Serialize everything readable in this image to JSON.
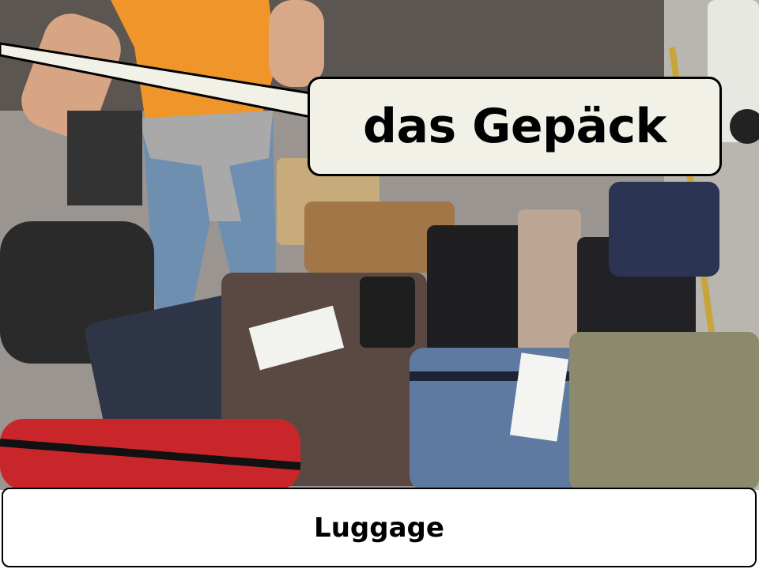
{
  "slide": {
    "speech_bubble_text": "das Gepäck",
    "caption_text": "Luggage"
  },
  "photo": {
    "subject": "pile-of-luggage-icon"
  },
  "colors": {
    "bubble_fill": "#f1f1e8",
    "caption_fill": "#ffffff",
    "outline": "#000000"
  }
}
